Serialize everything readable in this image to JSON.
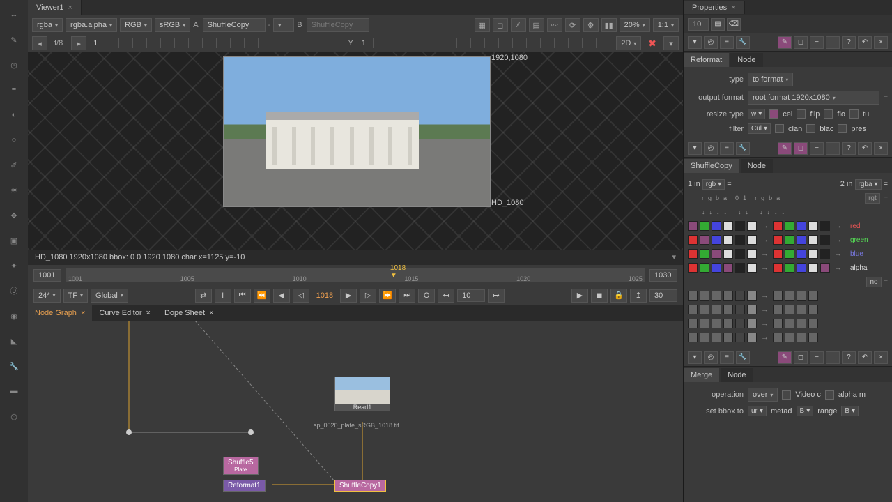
{
  "viewer": {
    "tab": "Viewer1",
    "channels": "rgba",
    "alpha": "rgba.alpha",
    "rgb": "RGB",
    "colorspace": "sRGB",
    "a_label": "A",
    "a_node": "ShuffleCopy",
    "b_label": "B",
    "b_node": "ShuffleCopy",
    "zoom": "20%",
    "ratio": "1:1",
    "view_mode": "2D",
    "fstop_label": "f/8",
    "fstop_val": "1",
    "y_label": "Y",
    "y_val": "1",
    "dim_tr": "1920,1080",
    "dim_br": "HD_1080",
    "status": "HD_1080 1920x1080  bbox: 0 0 1920 1080 char  x=1125 y=-10"
  },
  "timeline": {
    "start": "1001",
    "end": "1030",
    "ticks": [
      "1001",
      "1005",
      "1010",
      "1015",
      "1020",
      "1025"
    ],
    "current": "1018",
    "fps": "24*",
    "tf": "TF",
    "sync": "Global",
    "step": "10",
    "frame_out": "30"
  },
  "panels": {
    "node_graph": "Node Graph",
    "curve_editor": "Curve Editor",
    "dope_sheet": "Dope Sheet"
  },
  "nodes": {
    "read1": "Read1",
    "read1_file": "sp_0020_plate_sRGB_1018.tif",
    "shuffle5": "Shuffle5",
    "shuffle5_sub": "Plate",
    "reformat1": "Reformat1",
    "shufflecopy1": "ShuffleCopy1"
  },
  "props": {
    "title": "Properties",
    "count": "10",
    "reformat": {
      "tab1": "Reformat",
      "tab2": "Node",
      "type_lbl": "type",
      "type_val": "to format",
      "outfmt_lbl": "output format",
      "outfmt_val": "root.format 1920x1080",
      "resize_lbl": "resize type",
      "resize_val": "w",
      "resize_opts": [
        "cel",
        "flip",
        "flo",
        "tul"
      ],
      "filter_lbl": "filter",
      "filter_val": "Cul",
      "filter_opts": [
        "clan",
        "blac",
        "pres"
      ]
    },
    "shufflecopy": {
      "tab1": "ShuffleCopy",
      "tab2": "Node",
      "in1": "1 in",
      "in1_val": "rgb",
      "in2": "2 in",
      "in2_val": "rgba",
      "hdr": [
        "r",
        "g",
        "b",
        "a",
        "0",
        "1",
        "r",
        "g",
        "b",
        "a"
      ],
      "rgt": "rgt",
      "rows": [
        "red",
        "green",
        "blue",
        "alpha"
      ],
      "no": "no"
    },
    "merge": {
      "tab1": "Merge",
      "tab2": "Node",
      "op_lbl": "operation",
      "op_val": "over",
      "videoc": "Video c",
      "alpham": "alpha m",
      "bbox_lbl": "set bbox to",
      "bbox_val": "ur",
      "metad": "metad",
      "metad_val": "B",
      "range": "range",
      "range_val": "B"
    }
  }
}
